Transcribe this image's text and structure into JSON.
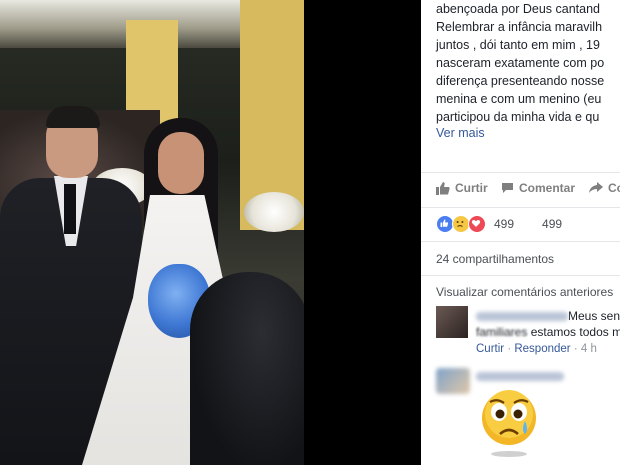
{
  "post": {
    "text_lines": [
      "abençoada por Deus cantand",
      "Relembrar a infância maravilh",
      "juntos , dói tanto em mim , 19",
      "nasceram exatamente com po",
      "diferença presenteando nosse",
      "menina e com um menino (eu",
      "participou da minha vida e qu"
    ],
    "see_more": "Ver mais"
  },
  "actions": {
    "like": "Curtir",
    "comment": "Comentar",
    "share": "Co"
  },
  "reactions": {
    "count_left": "499",
    "count_right": "499",
    "icons": [
      "like-icon",
      "sad-icon",
      "love-icon"
    ],
    "colors": {
      "like": "#4a7ef0",
      "sad": "#f6c744",
      "love": "#ed4956"
    }
  },
  "shares": "24 compartilhamentos",
  "comments": {
    "previous_link": "Visualizar comentários anteriores",
    "first": {
      "line1_suffix": "Meus sentim",
      "line2_prefix": "familiares",
      "line2_suffix": "estamos todos m",
      "like_link": "Curtir",
      "reply_link": "Responder",
      "age": "4 h"
    },
    "sticker": "crying-face-sticker"
  },
  "photo": {
    "description_icon": "wedding-photo"
  }
}
